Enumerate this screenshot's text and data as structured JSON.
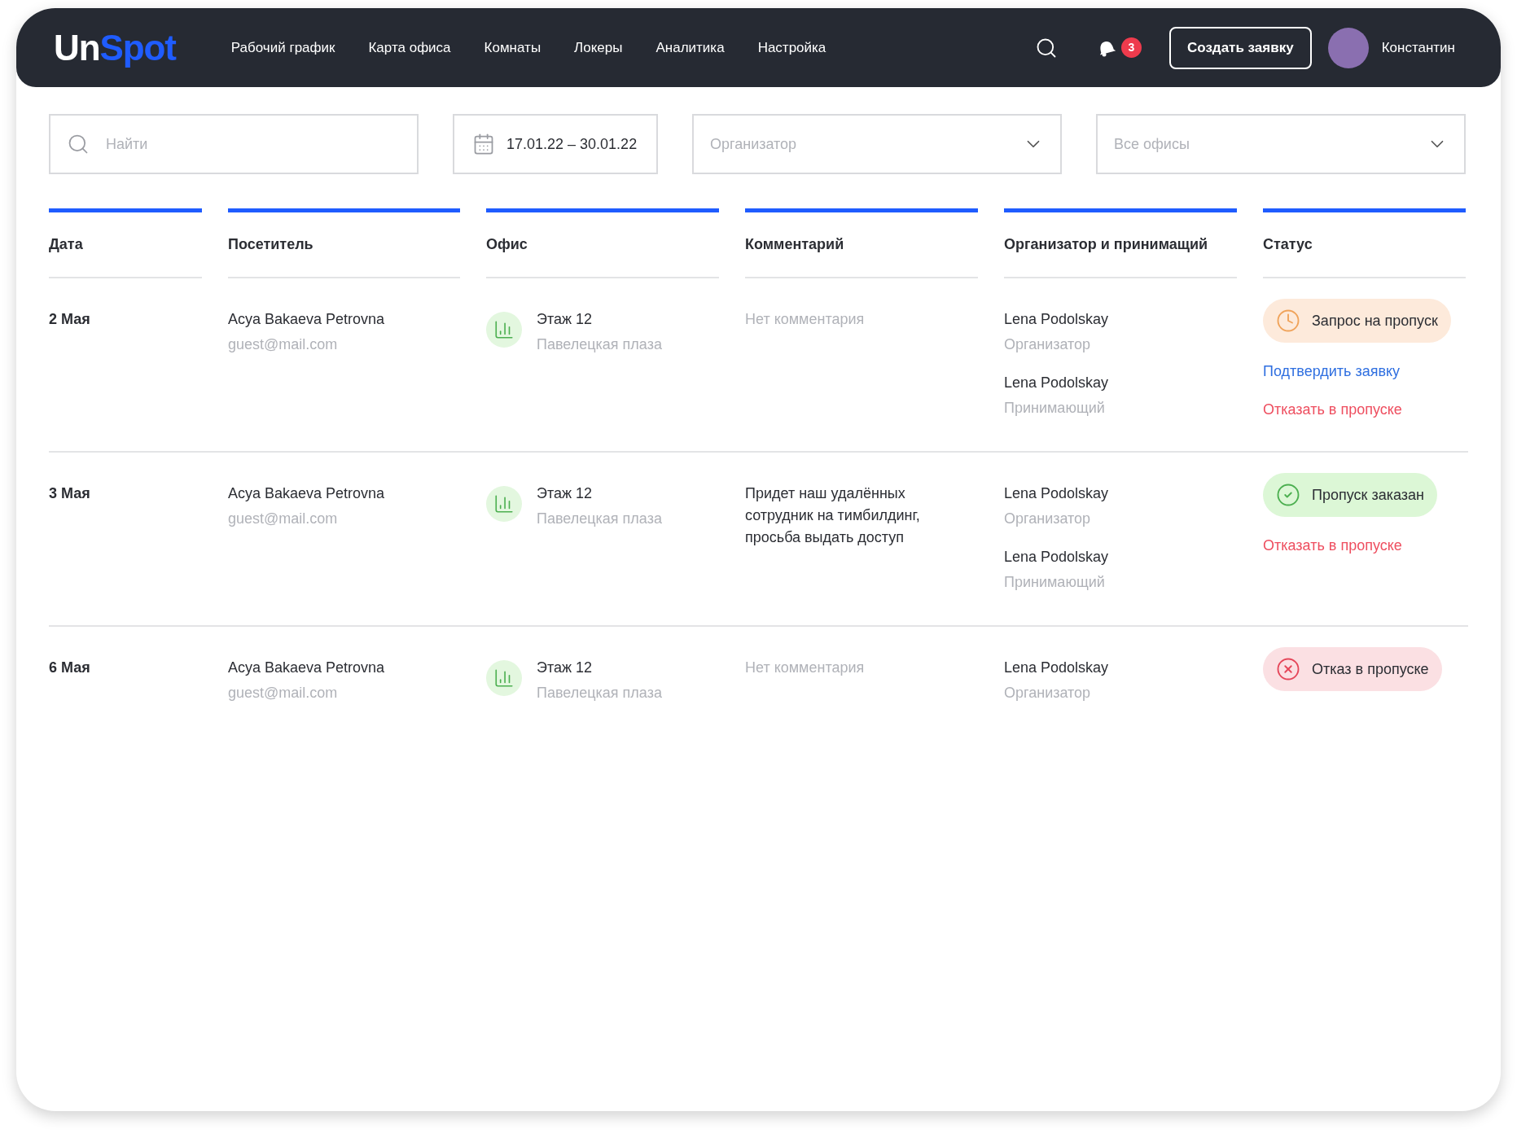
{
  "header": {
    "logo": {
      "first": "Un",
      "second": "Spot"
    },
    "nav": [
      {
        "label": "Рабочий график",
        "selected": false
      },
      {
        "label": "Карта офиса",
        "selected": false
      },
      {
        "label": "Комнаты",
        "selected": false
      },
      {
        "label": "Локеры",
        "selected": false
      },
      {
        "label": "Аналитика",
        "selected": false
      },
      {
        "label": "Настройка",
        "selected": false
      }
    ],
    "notifications": "3",
    "create_button": "Создать заявку",
    "user": "Константин"
  },
  "filters": {
    "search": {
      "placeholder": "Найти"
    },
    "date_range": "17.01.22 – 30.01.22",
    "organizer": {
      "placeholder": "Организатор"
    },
    "office": {
      "placeholder": "Все офисы"
    }
  },
  "table": {
    "columns": [
      "Дата",
      "Посетитель",
      "Офис",
      "Комментарий",
      "Организатор и принимащий",
      "Статус"
    ],
    "rows": [
      {
        "date": "2 Мая",
        "visitor": "Acya Bakaeva Petrovna",
        "email": "guest@mail.com",
        "floor": "Этаж 12",
        "office": "Павелецкая плаза",
        "comment": "Нет комментария",
        "comment_empty": true,
        "people": [
          {
            "name": "Lena Podolskay",
            "role": "Организатор"
          },
          {
            "name": "Lena Podolskay",
            "role": "Принимающий"
          }
        ],
        "status": {
          "kind": "pending",
          "label": "Запрос на пропуск"
        },
        "actions": [
          {
            "kind": "confirm",
            "label": "Подтвердить заявку"
          },
          {
            "kind": "reject",
            "label": "Отказать в пропуске"
          }
        ]
      },
      {
        "date": "3 Мая",
        "visitor": "Acya Bakaeva Petrovna",
        "email": "guest@mail.com",
        "floor": "Этаж 12",
        "office": "Павелецкая плаза",
        "comment": "Придет наш удалённых сотрудник на тимбилдинг, просьба выдать доступ",
        "comment_empty": false,
        "people": [
          {
            "name": "Lena Podolskay",
            "role": "Организатор"
          },
          {
            "name": "Lena Podolskay",
            "role": "Принимающий"
          }
        ],
        "status": {
          "kind": "approved",
          "label": "Пропуск заказан"
        },
        "actions": [
          {
            "kind": "reject",
            "label": "Отказать в пропуске"
          }
        ]
      },
      {
        "date": "6 Мая",
        "visitor": "Acya Bakaeva Petrovna",
        "email": "guest@mail.com",
        "floor": "Этаж 12",
        "office": "Павелецкая плаза",
        "comment": "Нет комментария",
        "comment_empty": true,
        "people": [
          {
            "name": "Lena Podolskay",
            "role": "Организатор"
          }
        ],
        "status": {
          "kind": "rejected",
          "label": "Отказ в пропуске"
        }
      }
    ]
  }
}
